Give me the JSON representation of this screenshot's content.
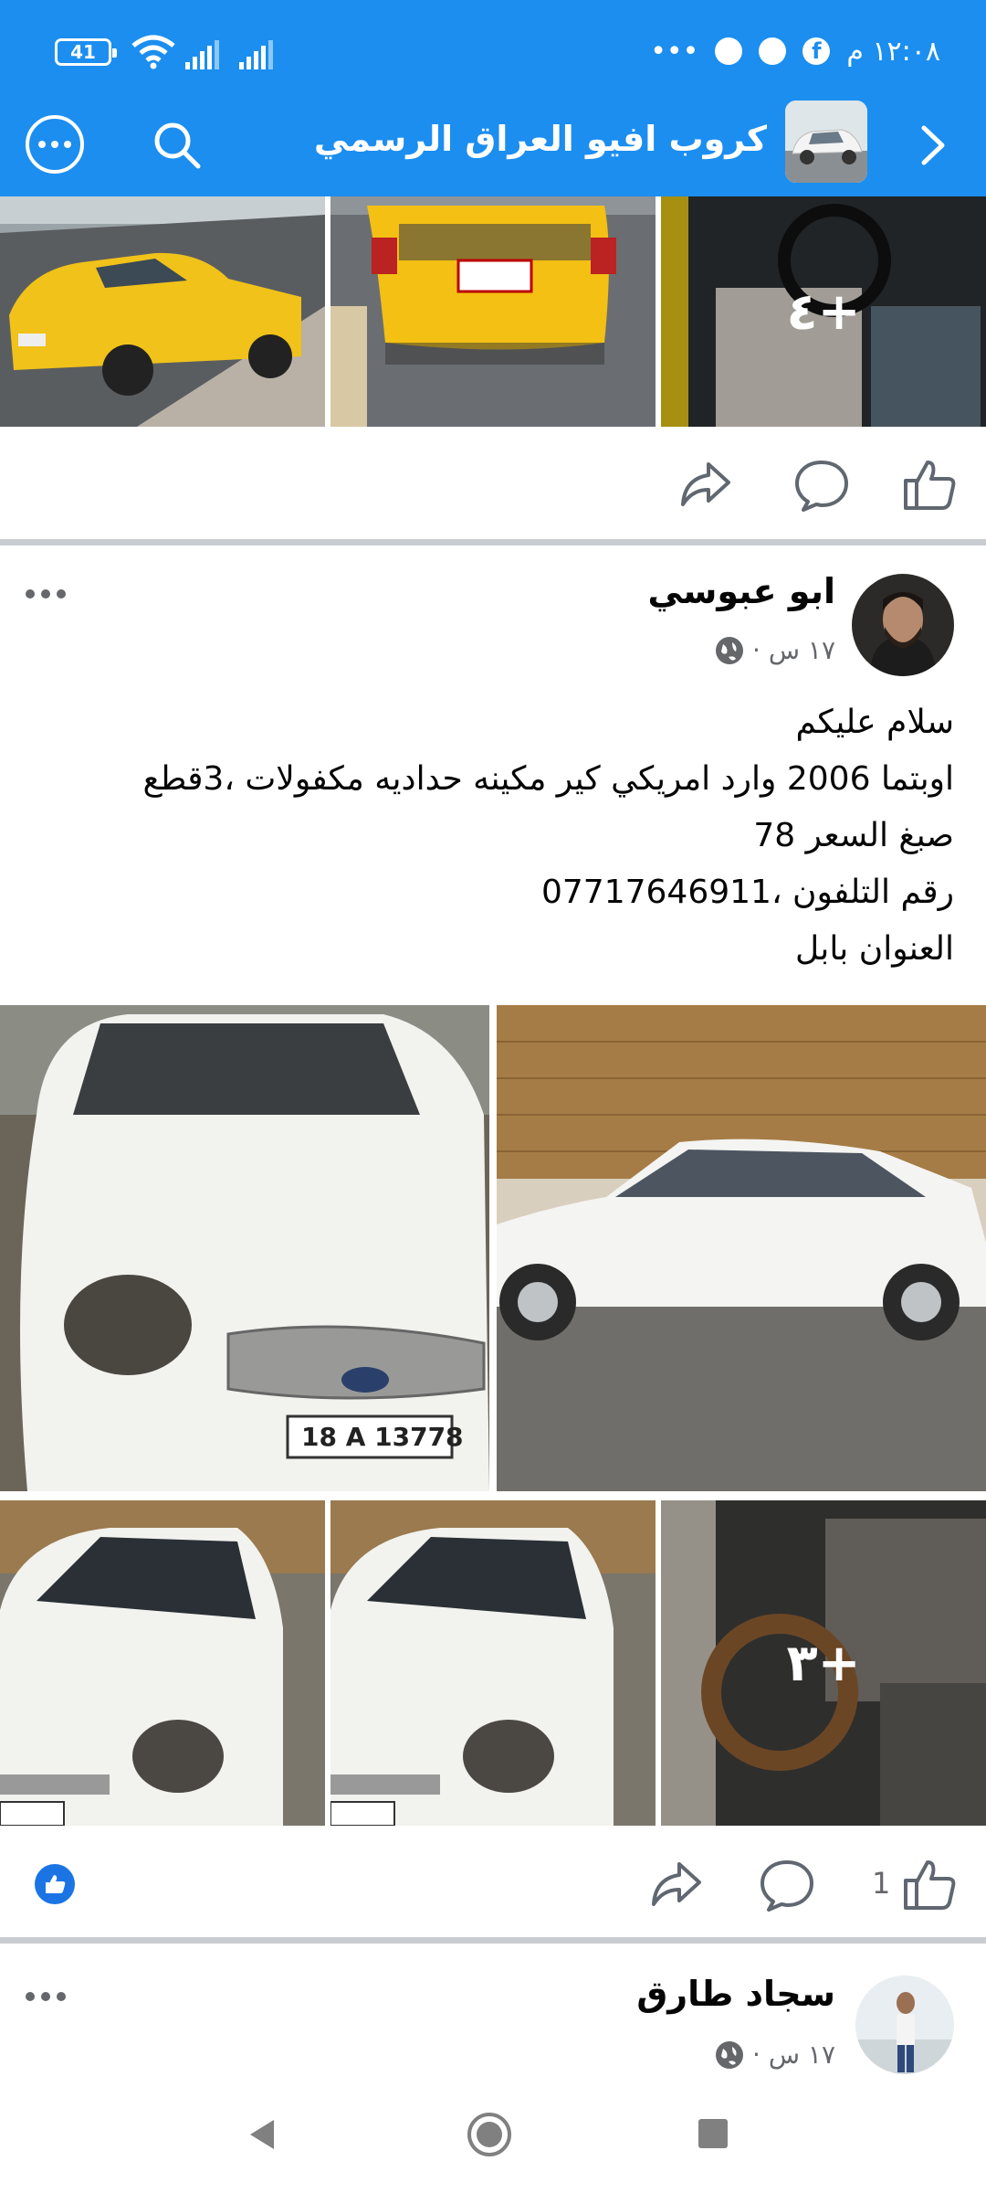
{
  "status_bar": {
    "time": "١٢:٠٨ م",
    "battery": "41",
    "more_indicator": "•••"
  },
  "header": {
    "group_name": "كروب افيو العراق الرسمي"
  },
  "post_1": {
    "more_photos": "+٤"
  },
  "post_2": {
    "author": "ابو عبوسي",
    "time": "١٧ س ·",
    "lines": [
      "سلام عليكم",
      "اوبتما 2006 وارد امريكي كير مكينه حداديه مكفولات ،3قطع",
      "صبغ السعر 78",
      "رقم التلفون ،07717646911",
      "العنوان بابل"
    ],
    "more_photos": "+٣",
    "like_count": "1"
  },
  "post_3": {
    "author": "سجاد طارق",
    "time": "١٧ س ·"
  },
  "colors": {
    "header_bg": "#1b8ef0",
    "like_blue": "#1b74e4",
    "secondary_text": "#65676b"
  }
}
